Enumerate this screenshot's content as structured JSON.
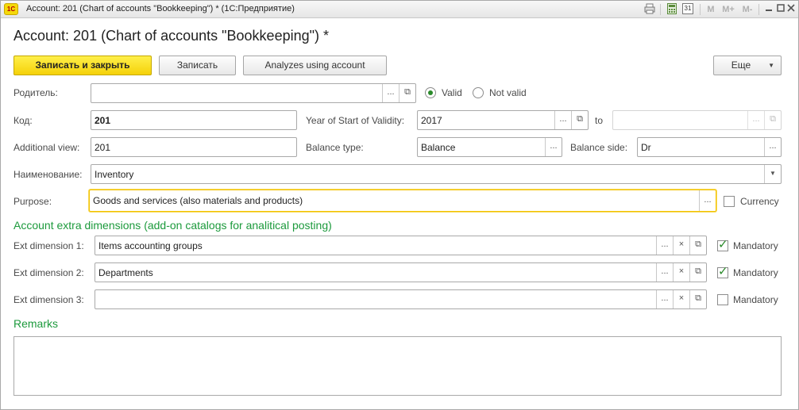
{
  "window": {
    "title": "Account: 201 (Chart of accounts \"Bookkeeping\") *  (1С:Предприятие)",
    "logo": "1С",
    "toolbar_icons": [
      "print-icon",
      "calculator-icon",
      "calendar-icon",
      "M",
      "M+",
      "M-",
      "minimize-icon",
      "maximize-icon",
      "close-icon"
    ],
    "calendar_day": "31",
    "m_label": "M",
    "mplus_label": "M+",
    "mminus_label": "M-"
  },
  "form": {
    "title": "Account: 201 (Chart of accounts \"Bookkeeping\") *"
  },
  "commands": {
    "save_close": "Записать и закрыть",
    "save": "Записать",
    "analyzes": "Analyzes using account",
    "more": "Еще"
  },
  "fields": {
    "parent_label": "Родитель:",
    "parent_value": "",
    "valid_label": "Valid",
    "not_valid_label": "Not valid",
    "valid_selected": true,
    "code_label": "Код:",
    "code_value": "201",
    "year_label": "Year of Start of Validity:",
    "year_value": "2017",
    "to_label": "to",
    "to_value": "",
    "additional_view_label": "Additional view:",
    "additional_view_value": "201",
    "balance_type_label": "Balance type:",
    "balance_type_value": "Balance",
    "balance_side_label": "Balance side:",
    "balance_side_value": "Dr",
    "name_label": "Наименование:",
    "name_value": "Inventory",
    "purpose_label": "Purpose:",
    "purpose_value": "Goods and services (also materials and products)",
    "currency_label": "Currency",
    "currency_checked": false
  },
  "dimensions": {
    "section_title": "Account extra dimensions (add-on catalogs for analitical posting)",
    "mandatory_label": "Mandatory",
    "items": [
      {
        "label": "Ext dimension 1:",
        "value": "Items accounting groups",
        "mandatory": true
      },
      {
        "label": "Ext dimension 2:",
        "value": "Departments",
        "mandatory": true
      },
      {
        "label": "Ext dimension 3:",
        "value": "",
        "mandatory": false
      }
    ]
  },
  "remarks": {
    "title": "Remarks",
    "value": ""
  },
  "colors": {
    "accent_green": "#1c9a3c",
    "primary_button": "#f5d109",
    "focus_border": "#f2c200"
  }
}
